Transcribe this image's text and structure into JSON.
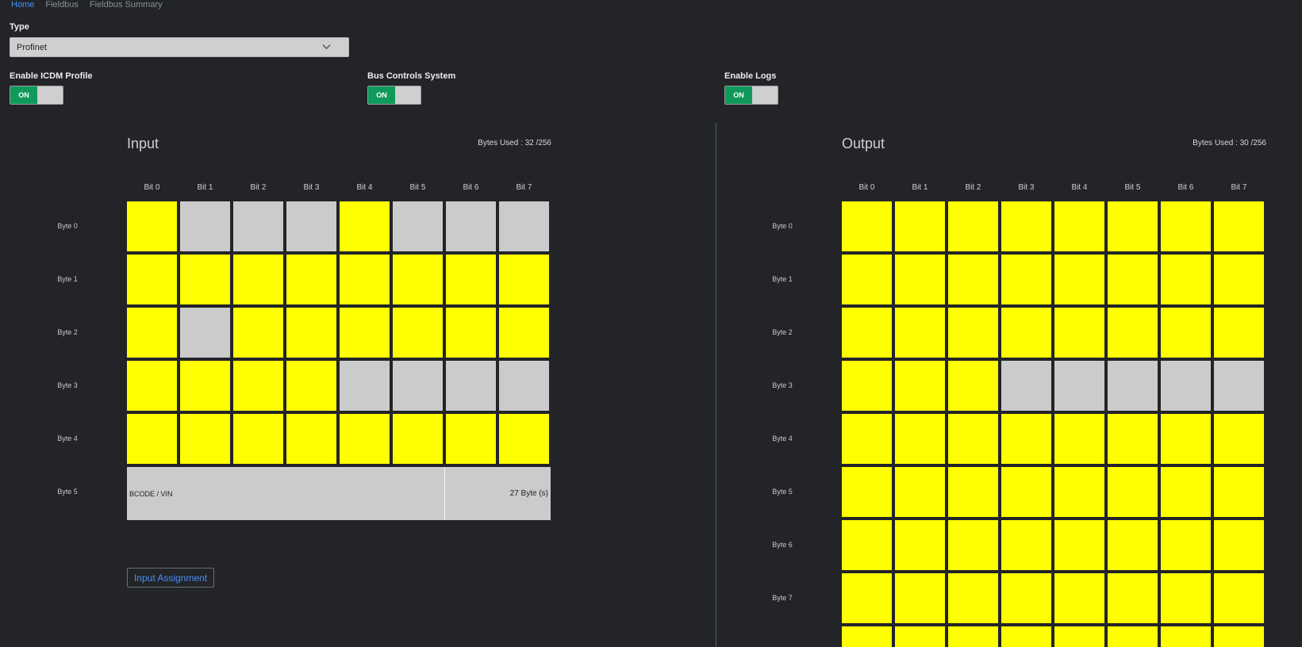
{
  "nav": {
    "items": [
      "Home",
      "Fieldbus",
      "Fieldbus Summary"
    ]
  },
  "type": {
    "label": "Type",
    "value": "Profinet"
  },
  "toggles": [
    {
      "label": "Enable ICDM Profile",
      "state": "ON"
    },
    {
      "label": "Bus Controls System",
      "state": "ON"
    },
    {
      "label": "Enable Logs",
      "state": "ON"
    }
  ],
  "colors": {
    "assigned": "#ffff00",
    "unassigned": "#cbcbcb",
    "toggle_on": "#0f9a5b",
    "link": "#4a90f5"
  },
  "input": {
    "title": "Input",
    "bytes_used": "Bytes Used : 32 /256",
    "bit_headers": [
      "Bit 0",
      "Bit 1",
      "Bit 2",
      "Bit 3",
      "Bit 4",
      "Bit 5",
      "Bit 6",
      "Bit 7"
    ],
    "byte_labels": [
      "Byte 0",
      "Byte 1",
      "Byte 2",
      "Byte 3",
      "Byte 4",
      "Byte 5"
    ],
    "grid": [
      [
        1,
        0,
        0,
        0,
        1,
        0,
        0,
        0
      ],
      [
        1,
        1,
        1,
        1,
        1,
        1,
        1,
        1
      ],
      [
        1,
        0,
        1,
        1,
        1,
        1,
        1,
        1
      ],
      [
        1,
        1,
        1,
        1,
        0,
        0,
        0,
        0
      ],
      [
        1,
        1,
        1,
        1,
        1,
        1,
        1,
        1
      ]
    ],
    "wide_row": {
      "label": "BCODE / VIN",
      "size": "27 Byte (s)"
    },
    "assign_button": "Input Assignment"
  },
  "output": {
    "title": "Output",
    "bytes_used": "Bytes Used : 30 /256",
    "bit_headers": [
      "Bit 0",
      "Bit 1",
      "Bit 2",
      "Bit 3",
      "Bit 4",
      "Bit 5",
      "Bit 6",
      "Bit 7"
    ],
    "byte_labels": [
      "Byte 0",
      "Byte 1",
      "Byte 2",
      "Byte 3",
      "Byte 4",
      "Byte 5",
      "Byte 6",
      "Byte 7"
    ],
    "grid": [
      [
        1,
        1,
        1,
        1,
        1,
        1,
        1,
        1
      ],
      [
        1,
        1,
        1,
        1,
        1,
        1,
        1,
        1
      ],
      [
        1,
        1,
        1,
        1,
        1,
        1,
        1,
        1
      ],
      [
        1,
        1,
        1,
        0,
        0,
        0,
        0,
        0
      ],
      [
        1,
        1,
        1,
        1,
        1,
        1,
        1,
        1
      ],
      [
        1,
        1,
        1,
        1,
        1,
        1,
        1,
        1
      ],
      [
        1,
        1,
        1,
        1,
        1,
        1,
        1,
        1
      ],
      [
        1,
        1,
        1,
        1,
        1,
        1,
        1,
        1
      ],
      [
        1,
        1,
        1,
        1,
        1,
        1,
        1,
        1
      ]
    ]
  }
}
